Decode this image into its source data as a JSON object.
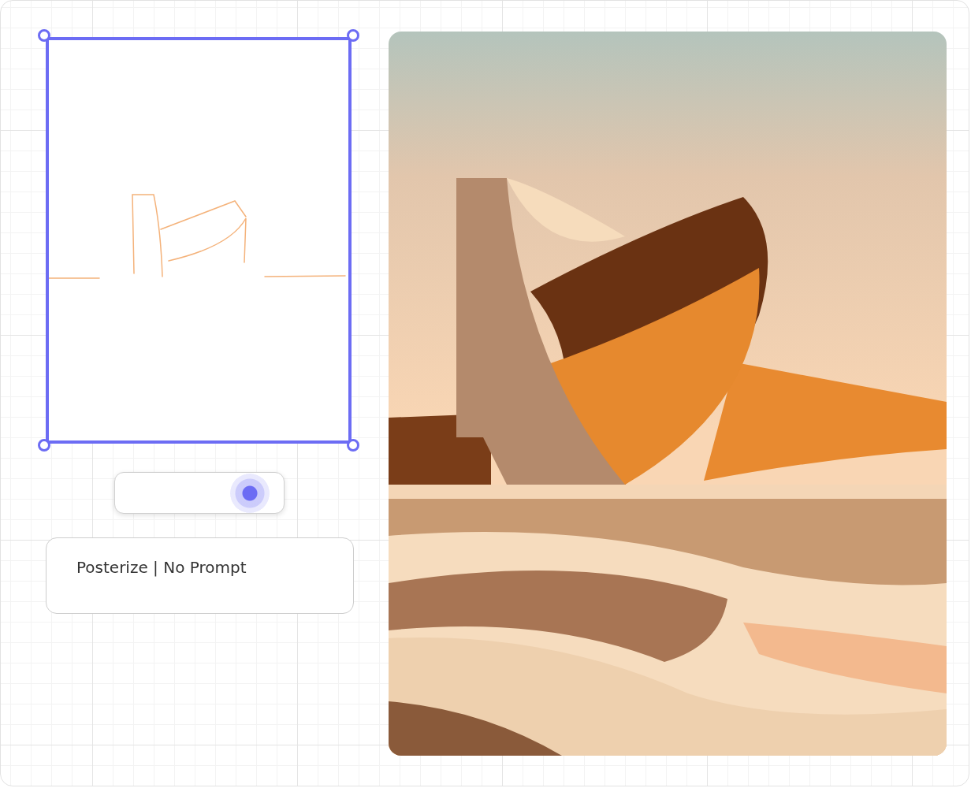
{
  "slider": {
    "level": 0.8
  },
  "prompt_box": {
    "text": "Posterize | No Prompt"
  }
}
